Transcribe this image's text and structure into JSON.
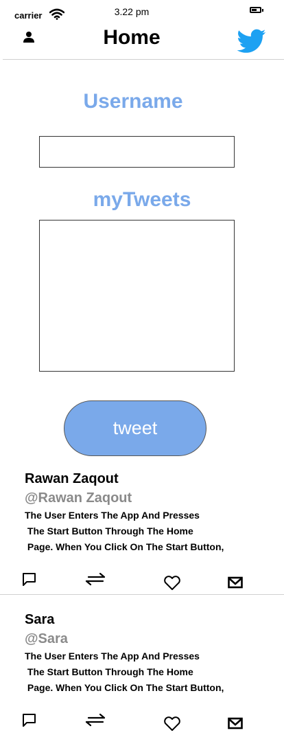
{
  "status_bar": {
    "carrier": "carrier",
    "time": "3.22 pm",
    "wifi_icon": "wifi-icon",
    "battery_icon": "battery-icon"
  },
  "nav": {
    "title": "Home",
    "profile_icon": "user-icon",
    "logo_icon": "twitter-bird-icon",
    "logo_color": "#1DA1F2"
  },
  "form": {
    "username_label": "Username",
    "tweets_label": "myTweets",
    "username_value": "",
    "tweet_value": "",
    "submit_label": "tweet",
    "accent": "#7aa9ea"
  },
  "tweets": [
    {
      "name": "Rawan Zaqout",
      "handle": "@Rawan Zaqout",
      "lines": [
        "The User Enters The App And Presses",
        " The Start Button Through The Home",
        " Page. When You Click On The Start Button,"
      ],
      "actions": [
        "comment-icon",
        "retweet-icon",
        "like-icon",
        "mail-icon"
      ]
    },
    {
      "name": "Sara",
      "handle": "@Sara",
      "lines": [
        "The User Enters The App And Presses",
        " The Start Button Through The Home",
        " Page. When You Click On The Start Button,"
      ],
      "actions": [
        "comment-icon",
        "retweet-icon",
        "like-icon",
        "mail-icon"
      ]
    }
  ]
}
